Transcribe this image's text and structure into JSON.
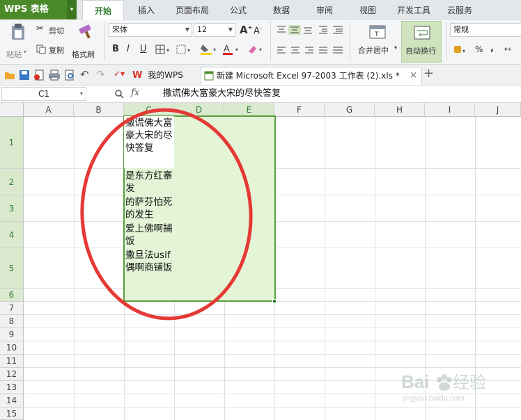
{
  "app": {
    "title": "WPS 表格"
  },
  "menu_tabs": [
    "开始",
    "插入",
    "页面布局",
    "公式",
    "数据",
    "审阅",
    "视图",
    "开发工具",
    "云服务"
  ],
  "ribbon": {
    "paste": "粘贴",
    "cut": "剪切",
    "copy": "复制",
    "format_painter": "格式刷",
    "font_name": "宋体",
    "font_size": "12",
    "bold": "B",
    "italic": "I",
    "underline": "U",
    "merge_center": "合并居中",
    "wrap_text": "自动换行",
    "number_format": "常规",
    "percent": "%"
  },
  "doc_tabs": [
    {
      "label": "我的WPS"
    },
    {
      "label": "新建 Microsoft Excel 97-2003 工作表 (2).xls *"
    }
  ],
  "formula_bar": {
    "cell_ref": "C1",
    "fx": "fx",
    "content": "撒谎佛大富豪大宋的尽快答复"
  },
  "columns": [
    "A",
    "B",
    "C",
    "D",
    "E",
    "F",
    "G",
    "H",
    "I",
    "J"
  ],
  "rows": [
    "1",
    "2",
    "3",
    "4",
    "5",
    "6",
    "7",
    "8",
    "9",
    "10",
    "11",
    "12",
    "13",
    "14",
    "15"
  ],
  "cells": {
    "C1": "撒谎佛大富豪大宋的尽快答复",
    "C2": "是东方红寨发",
    "C3": "的萨芬怕死的发生",
    "C4": "爱上佛啊捕饭",
    "C5": "撒旦法usif偶啊商铺饭"
  },
  "annotation_color": "#e53935",
  "accent_color": "#2f7d32",
  "watermark": "Baidu经验 jingyan.baidu.com"
}
